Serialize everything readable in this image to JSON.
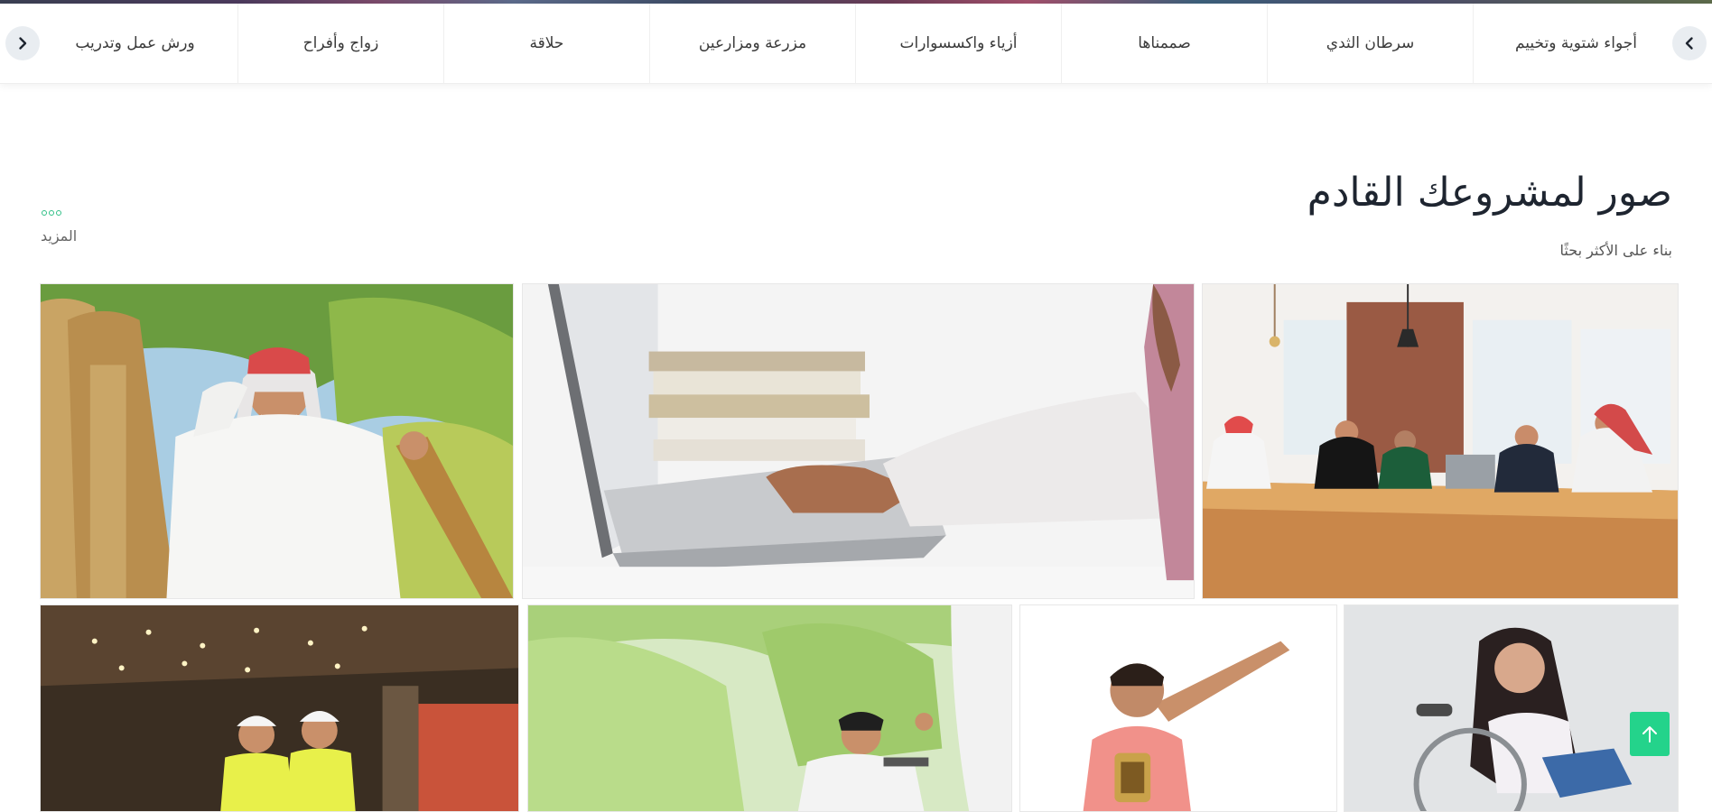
{
  "nav": {
    "categories": [
      {
        "label": "أجواء شتوية وتخييم"
      },
      {
        "label": "سرطان الثدي"
      },
      {
        "label": "صممناها"
      },
      {
        "label": "أزياء واكسسوارات"
      },
      {
        "label": "مزرعة ومزارعين"
      },
      {
        "label": "حلاقة"
      },
      {
        "label": "زواج وأفراح"
      },
      {
        "label": "ورش عمل وتدريب"
      }
    ],
    "prev_icon": "chevron-right-icon",
    "next_icon": "chevron-left-icon"
  },
  "section": {
    "title": "صور لمشروعك القادم",
    "subtitle": "بناء على الأكثر بحثًا",
    "more_label": "المزيد"
  },
  "photos": [
    {
      "subject": "meeting"
    },
    {
      "subject": "laptop"
    },
    {
      "subject": "farmer"
    },
    {
      "subject": "wheelchair-girl"
    },
    {
      "subject": "boy-lantern"
    },
    {
      "subject": "wheelchair-boy"
    },
    {
      "subject": "warehouse-workers"
    }
  ],
  "to_top_icon": "arrow-up-icon",
  "colors": {
    "accent": "#24d38b",
    "title": "#1e2530",
    "nav_text": "#3b3b3b"
  }
}
